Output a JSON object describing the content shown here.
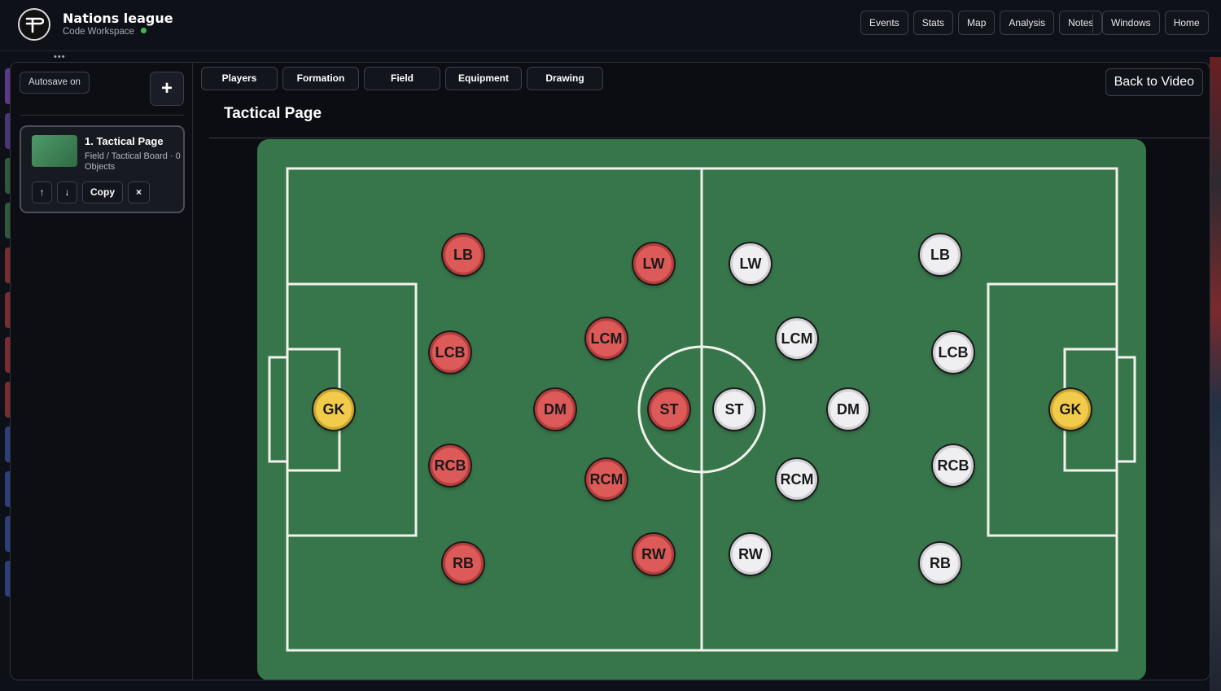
{
  "header": {
    "title": "Nations league",
    "subtitle": "Code Workspace",
    "status_color": "#3fb950",
    "nav": [
      "Events",
      "Stats",
      "Map",
      "Analysis",
      "Notes"
    ],
    "nav_right": [
      "Windows",
      "Home"
    ],
    "logo_icon": "brand-logo-icon"
  },
  "sidebar": {
    "autosave": "Autosave on",
    "add_label": "+",
    "pages": [
      {
        "title": "1. Tactical Page",
        "meta": "Field / Tactical Board · 0 Objects",
        "up": "↑",
        "down": "↓",
        "copy": "Copy",
        "remove": "×"
      }
    ]
  },
  "tabs": [
    "Players",
    "Formation",
    "Field",
    "Equipment",
    "Drawing"
  ],
  "back_label": "Back to Video",
  "page_title": "Tactical Page",
  "colors": {
    "pitch": "#37754a",
    "home_team": "#dc5a58",
    "away_team": "#efeff1",
    "goalkeeper": "#f2cb4b"
  },
  "home_players": [
    "GK",
    "LB",
    "LCB",
    "RCB",
    "RB",
    "LW",
    "LCM",
    "DM",
    "RCM",
    "RW",
    "ST"
  ],
  "away_players": [
    "GK",
    "LB",
    "LCB",
    "RCB",
    "RB",
    "LW",
    "LCM",
    "DM",
    "RCM",
    "RW",
    "ST"
  ]
}
